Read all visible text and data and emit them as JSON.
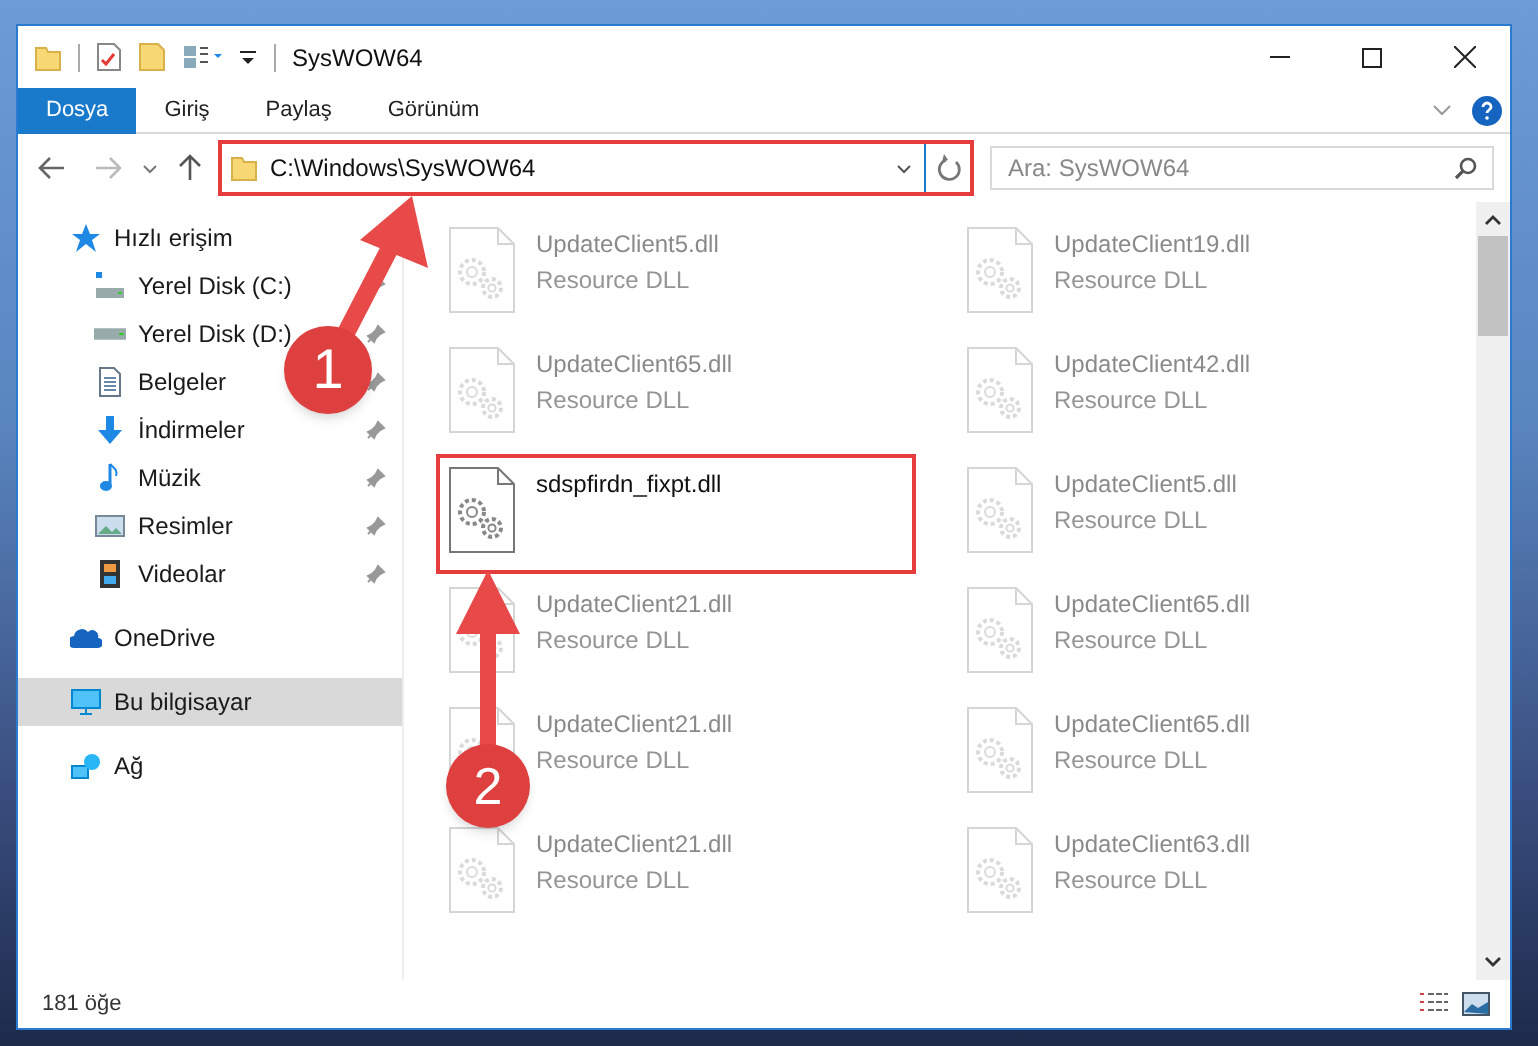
{
  "window": {
    "title": "SysWOW64"
  },
  "ribbon_tabs": [
    {
      "label": "Dosya",
      "selected": true
    },
    {
      "label": "Giriş",
      "selected": false
    },
    {
      "label": "Paylaş",
      "selected": false
    },
    {
      "label": "Görünüm",
      "selected": false
    }
  ],
  "address": {
    "path": "C:\\Windows\\SysWOW64"
  },
  "search": {
    "placeholder": "Ara: SysWOW64"
  },
  "sidebar": {
    "items": [
      {
        "label": "Hızlı erişim",
        "kind": "quick",
        "selected": false,
        "pinned": false,
        "children": [
          {
            "label": "Yerel Disk (C:)",
            "kind": "disk-c",
            "selected": false,
            "pinned": true
          },
          {
            "label": "Yerel Disk (D:)",
            "kind": "disk",
            "selected": false,
            "pinned": true
          },
          {
            "label": "Belgeler",
            "kind": "docs",
            "selected": false,
            "pinned": true
          },
          {
            "label": "İndirmeler",
            "kind": "downloads",
            "selected": false,
            "pinned": true
          },
          {
            "label": "Müzik",
            "kind": "music",
            "selected": false,
            "pinned": true
          },
          {
            "label": "Resimler",
            "kind": "pictures",
            "selected": false,
            "pinned": true
          },
          {
            "label": "Videolar",
            "kind": "videos",
            "selected": false,
            "pinned": true
          }
        ]
      },
      {
        "label": "OneDrive",
        "kind": "cloud",
        "selected": false,
        "pinned": false
      },
      {
        "label": "Bu bilgisayar",
        "kind": "pc",
        "selected": true,
        "pinned": false
      },
      {
        "label": "Ağ",
        "kind": "network",
        "selected": false,
        "pinned": false
      }
    ]
  },
  "files": [
    {
      "name": "UpdateClient5.dll",
      "type": "Resource DLL",
      "highlighted": false
    },
    {
      "name": "UpdateClient19.dll",
      "type": "Resource DLL",
      "highlighted": false
    },
    {
      "name": "UpdateClient65.dll",
      "type": "Resource DLL",
      "highlighted": false
    },
    {
      "name": "UpdateClient42.dll",
      "type": "Resource DLL",
      "highlighted": false
    },
    {
      "name": "sdspfirdn_fixpt.dll",
      "highlighted": true
    },
    {
      "name": "UpdateClient5.dll",
      "type": "Resource DLL",
      "highlighted": false
    },
    {
      "name": "UpdateClient21.dll",
      "type": "Resource DLL",
      "highlighted": false
    },
    {
      "name": "UpdateClient65.dll",
      "type": "Resource DLL",
      "highlighted": false
    },
    {
      "name": "UpdateClient21.dll",
      "type": "Resource DLL",
      "highlighted": false
    },
    {
      "name": "UpdateClient65.dll",
      "type": "Resource DLL",
      "highlighted": false
    },
    {
      "name": "UpdateClient21.dll",
      "type": "Resource DLL",
      "highlighted": false
    },
    {
      "name": "UpdateClient63.dll",
      "type": "Resource DLL",
      "highlighted": false
    }
  ],
  "status_bar": {
    "count": "181 öğe"
  },
  "annotations": [
    {
      "number": "1"
    },
    {
      "number": "2"
    }
  ]
}
